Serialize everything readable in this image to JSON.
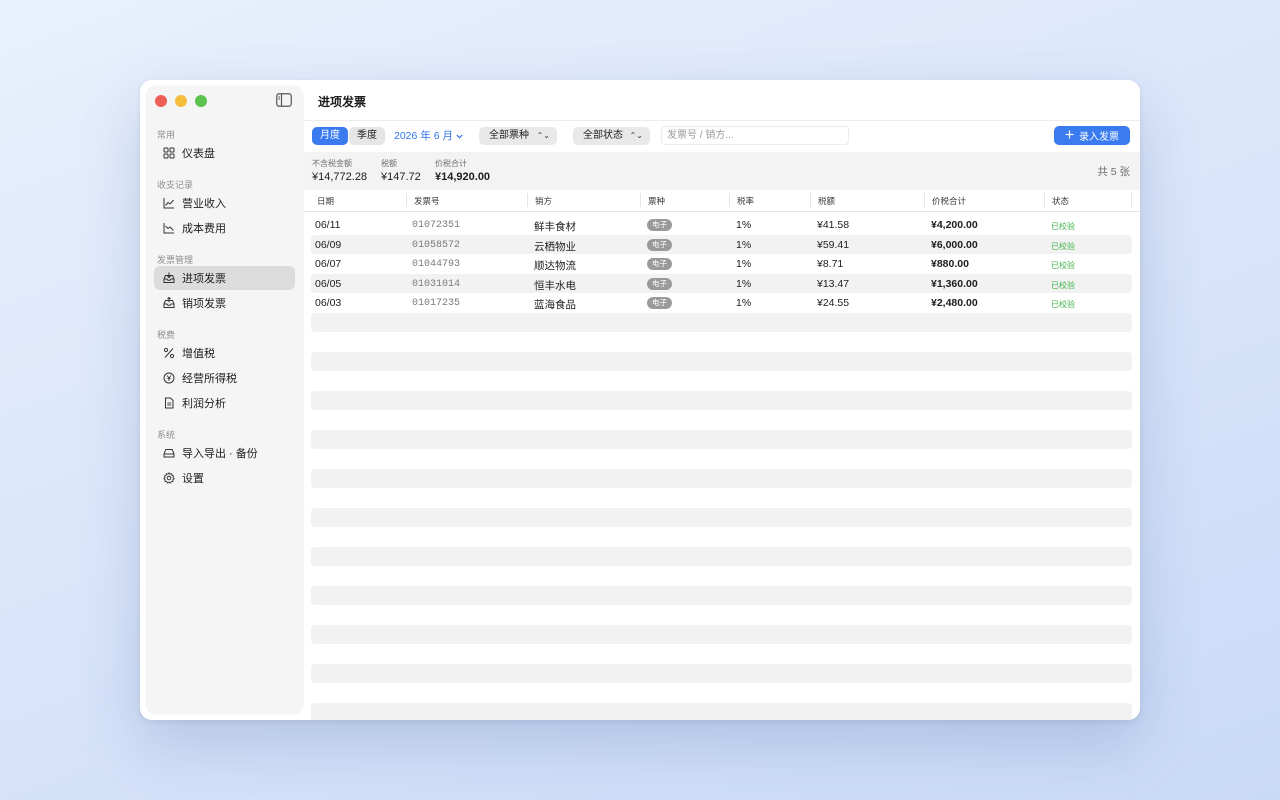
{
  "sidebar": {
    "sections": [
      {
        "title": "常用",
        "items": [
          {
            "label": "仪表盘",
            "icon": "grid-icon"
          }
        ]
      },
      {
        "title": "收支记录",
        "items": [
          {
            "label": "营业收入",
            "icon": "chart-up-icon"
          },
          {
            "label": "成本费用",
            "icon": "chart-down-icon"
          }
        ]
      },
      {
        "title": "发票管理",
        "items": [
          {
            "label": "进项发票",
            "icon": "tray-in-icon",
            "active": true
          },
          {
            "label": "销项发票",
            "icon": "tray-out-icon"
          }
        ]
      },
      {
        "title": "税费",
        "items": [
          {
            "label": "增值税",
            "icon": "percent-icon"
          },
          {
            "label": "经营所得税",
            "icon": "yen-circle-icon"
          },
          {
            "label": "利润分析",
            "icon": "document-icon"
          }
        ]
      },
      {
        "title": "系统",
        "items": [
          {
            "label": "导入导出 · 备份",
            "icon": "drive-icon"
          },
          {
            "label": "设置",
            "icon": "gear-icon"
          }
        ]
      }
    ]
  },
  "main": {
    "title": "进项发票",
    "toolbar": {
      "seg_month": "月度",
      "seg_quarter": "季度",
      "period": "2026 年 6 月",
      "type_select": "全部票种",
      "status_select": "全部状态",
      "search_placeholder": "发票号 / 销方...",
      "add_button": "录入发票"
    },
    "summary": {
      "pre_tax_label": "不含税金额",
      "pre_tax_value": "¥14,772.28",
      "tax_label": "税额",
      "tax_value": "¥147.72",
      "total_label": "价税合计",
      "total_value": "¥14,920.00",
      "count": "共 5 张"
    },
    "columns": [
      "日期",
      "发票号",
      "销方",
      "票种",
      "税率",
      "税额",
      "价税合计",
      "状态"
    ],
    "rows": [
      {
        "date": "06/11",
        "no": "01072351",
        "seller": "鲜丰食材",
        "type": "电子",
        "rate": "1%",
        "tax": "¥41.58",
        "total": "¥4,200.00",
        "status": "已校验"
      },
      {
        "date": "06/09",
        "no": "01058572",
        "seller": "云栖物业",
        "type": "电子",
        "rate": "1%",
        "tax": "¥59.41",
        "total": "¥6,000.00",
        "status": "已校验"
      },
      {
        "date": "06/07",
        "no": "01044793",
        "seller": "顺达物流",
        "type": "电子",
        "rate": "1%",
        "tax": "¥8.71",
        "total": "¥880.00",
        "status": "已校验"
      },
      {
        "date": "06/05",
        "no": "01031014",
        "seller": "恒丰水电",
        "type": "电子",
        "rate": "1%",
        "tax": "¥13.47",
        "total": "¥1,360.00",
        "status": "已校验"
      },
      {
        "date": "06/03",
        "no": "01017235",
        "seller": "蓝海食品",
        "type": "电子",
        "rate": "1%",
        "tax": "¥24.55",
        "total": "¥2,480.00",
        "status": "已校验"
      }
    ]
  }
}
